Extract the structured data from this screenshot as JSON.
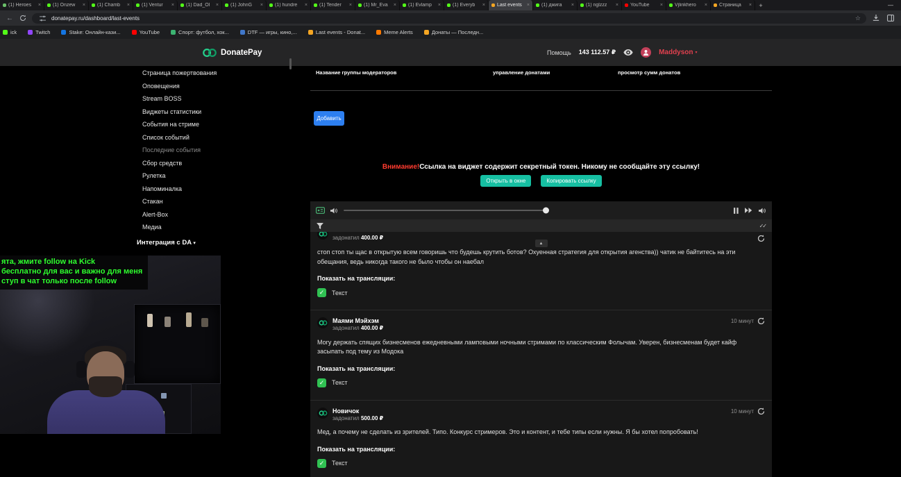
{
  "icons": {
    "close": "×",
    "new_tab": "+",
    "minimize": "—",
    "back": "←",
    "star": "☆",
    "up_arrow": "▲",
    "check": "✓",
    "double_check": "✓✓",
    "caret_down": "▾"
  },
  "browser": {
    "address": "donatepay.ru/dashboard/last-events",
    "tabs": [
      {
        "title": "(1) Heroes",
        "fav": "#6abf69",
        "active": false
      },
      {
        "title": "(1) Onzew",
        "fav": "#53fc18",
        "active": false
      },
      {
        "title": "(1) Chamb",
        "fav": "#53fc18",
        "active": false
      },
      {
        "title": "(1) Ventur",
        "fav": "#53fc18",
        "active": false
      },
      {
        "title": "(1) Dad_Ol",
        "fav": "#53fc18",
        "active": false
      },
      {
        "title": "(1) JohnG",
        "fav": "#53fc18",
        "active": false
      },
      {
        "title": "(1) hundre",
        "fav": "#53fc18",
        "active": false
      },
      {
        "title": "(1) Tender",
        "fav": "#53fc18",
        "active": false
      },
      {
        "title": "(1) Mr_Eva",
        "fav": "#53fc18",
        "active": false
      },
      {
        "title": "(1) Evlamp",
        "fav": "#53fc18",
        "active": false
      },
      {
        "title": "(1) Everyb",
        "fav": "#53fc18",
        "active": false
      },
      {
        "title": "Last events",
        "fav": "#f5a623",
        "active": true
      },
      {
        "title": "(1) джига",
        "fav": "#53fc18",
        "active": false
      },
      {
        "title": "(1) nglzzz",
        "fav": "#53fc18",
        "active": false
      },
      {
        "title": "YouTube",
        "fav": "#ff0000",
        "active": false
      },
      {
        "title": "Vjlinkhero",
        "fav": "#53fc18",
        "active": false
      },
      {
        "title": "Страница",
        "fav": "#f5a623",
        "active": false
      }
    ],
    "bookmarks": [
      {
        "label": "ick",
        "color": "#53fc18"
      },
      {
        "label": "Twitch",
        "color": "#9146ff"
      },
      {
        "label": "Stake: Онлайн-кази...",
        "color": "#1475e1"
      },
      {
        "label": "YouTube",
        "color": "#ff0000"
      },
      {
        "label": "Спорт: футбол, хок...",
        "color": "#3cb371"
      },
      {
        "label": "DTF — игры, кино,...",
        "color": "#4077c9"
      },
      {
        "label": "Last events - Donat...",
        "color": "#f5a623"
      },
      {
        "label": "Meme Alerts",
        "color": "#ff7a00"
      },
      {
        "label": "Донаты — Последн...",
        "color": "#f5a623"
      }
    ]
  },
  "header": {
    "brand": "DonatePay",
    "help_label": "Помощь",
    "balance": "143 112.57 ₽",
    "username": "Maddyson"
  },
  "sidebar": {
    "items": [
      {
        "label": "Страница пожертвования",
        "muted": false
      },
      {
        "label": "Оповещения",
        "muted": false
      },
      {
        "label": "Stream BOSS",
        "muted": false
      },
      {
        "label": "Виджеты статистики",
        "muted": false
      },
      {
        "label": "События на стриме",
        "muted": false
      },
      {
        "label": "Список событий",
        "muted": false
      },
      {
        "label": "Последние события",
        "muted": true
      },
      {
        "label": "Сбор средств",
        "muted": false
      },
      {
        "label": "Рулетка",
        "muted": false
      },
      {
        "label": "Напоминалка",
        "muted": false
      },
      {
        "label": "Стакан",
        "muted": false
      },
      {
        "label": "Alert-Box",
        "muted": false
      },
      {
        "label": "Медиа",
        "muted": false
      }
    ],
    "integration_label": "Интеграция с DA"
  },
  "main": {
    "table_headers": [
      "Название группы модераторов",
      "управление донатами",
      "просмотр сумм донатов"
    ],
    "add_button": "Добавить",
    "warning_prefix": "Внимание!",
    "warning_text": "Ссылка на виджет содержит секретный токен. Никому не сообщайте эту ссылку!",
    "open_button": "Открыть в окне",
    "copy_button": "Копировать ссылку"
  },
  "events": [
    {
      "name": "",
      "action": "задонатил",
      "amount": "400.00 ₽",
      "time": "",
      "message": "стоп стоп ты щас в открытую всем говоришь что будешь крутить ботов? Охуенная стратегия для открытия агенства)) чатик не байтитесь на эти обещания, ведь никогда такого не было чтобы он наебал",
      "show_label": "Показать на трансляции:",
      "toggle_label": "Текст"
    },
    {
      "name": "Маями Мэйхэм",
      "action": "задонатил",
      "amount": "400.00 ₽",
      "time": "10 минут",
      "message": "Могу держать спящих бизнесменов ежедневными ламповыми ночными стримами по классическим Фолычам. Уверен, бизнесменам будет кайф засыпать под тему из Модока",
      "show_label": "Показать на трансляции:",
      "toggle_label": "Текст"
    },
    {
      "name": "Новичок",
      "action": "задонатил",
      "amount": "500.00 ₽",
      "time": "10 минут",
      "message": "Мед, а почему не сделать из зрителей. Типо. Конкурс стримеров. Это и контент, и тебе типы если нужны. Я бы хотел попробовать!",
      "show_label": "Показать на трансляции:",
      "toggle_label": "Текст"
    }
  ],
  "stream_overlay": {
    "lines": [
      "ята, жмите follow на Kick",
      "бесплатно для вас и важно для меня",
      "ступ в чат только после follow"
    ]
  }
}
